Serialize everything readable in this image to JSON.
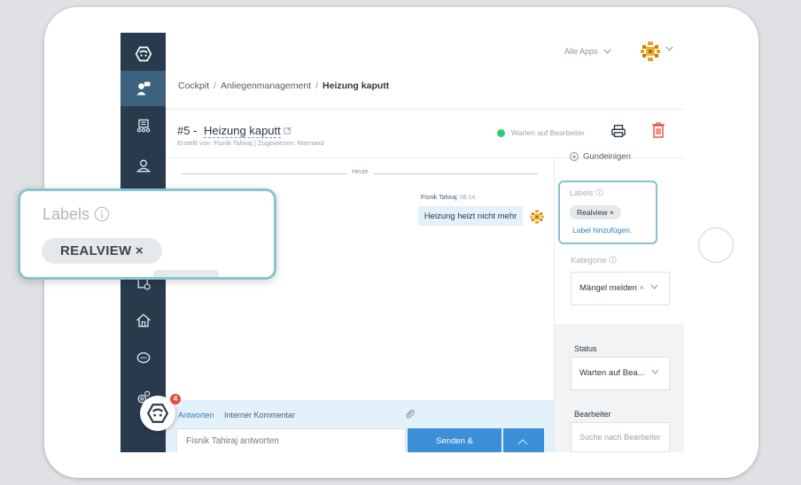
{
  "topbar": {
    "apps_label": "Alle Apps"
  },
  "breadcrumb": {
    "items": [
      "Cockpit",
      "Anliegenmanagement"
    ],
    "current": "Heizung kaputt"
  },
  "ticket": {
    "number": "#5 -",
    "title": "Heizung kaputt",
    "subtitle": "Erstellt von: Fisnik Tahiraj | Zugewiesen: Niemand",
    "status": "Warten auf Bearbeiter",
    "status_color": "#2ecc71"
  },
  "chat": {
    "day_divider": "Heute",
    "message": {
      "author": "Fisnik Tahiraj",
      "time": "08:14",
      "text": "Heizung heizt nicht mehr"
    }
  },
  "reply": {
    "tab_answer": "Antworten",
    "tab_comment": "Interner Kommentar",
    "placeholder": "Fisnik Tahiraj antworten",
    "send_label": "Senden &"
  },
  "right_panel": {
    "top_label": "Gundeinigen",
    "labels_title": "Labels",
    "label_chip": "Realview ×",
    "add_label": "Label hinzufügen.",
    "category_title": "Kategorie",
    "category_value": "Mängel melden",
    "status_title": "Status",
    "status_value": "Warten auf Bea...",
    "assignee_title": "Bearbeiter",
    "assignee_placeholder": "Suche nach Bearbeiter"
  },
  "callout": {
    "title": "Labels",
    "chip": "REALVIEW ×"
  },
  "fab": {
    "badge": "4"
  },
  "colors": {
    "sidebar": "#283b4d",
    "accent": "#3b8fd6",
    "highlight": "#86c4cf",
    "danger": "#e74c3c"
  }
}
